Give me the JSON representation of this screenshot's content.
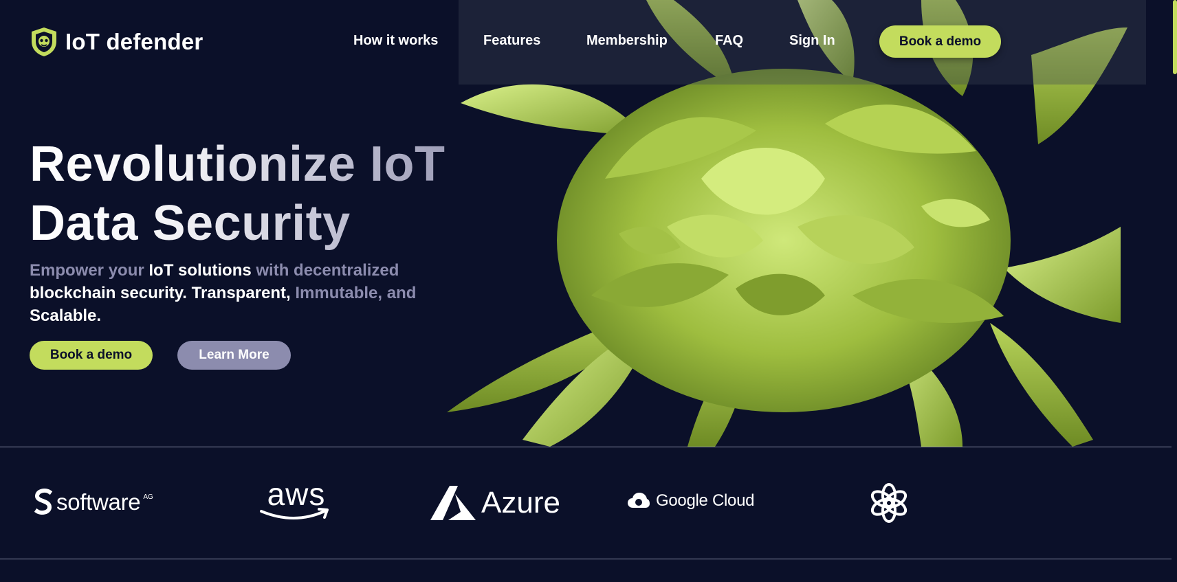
{
  "brand": {
    "name": "IoT defender",
    "icon": "shield-logo-icon",
    "accent_color": "#c3dc5d",
    "background_color": "#0b1029",
    "muted_text_color": "#8c8cae"
  },
  "nav": {
    "items": [
      {
        "label": "How it works"
      },
      {
        "label": "Features"
      },
      {
        "label": "Membership"
      },
      {
        "label": "FAQ"
      },
      {
        "label": "Sign In"
      }
    ],
    "cta_label": "Book a demo"
  },
  "hero": {
    "title_line1": "Revolutionize IoT",
    "title_line2": "Data Security",
    "subtitle_parts": [
      {
        "text": "Empower your ",
        "tone": "muted"
      },
      {
        "text": "IoT solutions",
        "tone": "bright"
      },
      {
        "text": " with decentralized ",
        "tone": "muted"
      },
      {
        "text": "blockchain security. Transparent, ",
        "tone": "bright"
      },
      {
        "text": "Immutable, and ",
        "tone": "muted"
      },
      {
        "text": "Scalable.",
        "tone": "bright"
      }
    ],
    "primary_button": "Book a demo",
    "secondary_button": "Learn More",
    "art": "green-abstract-flower-image"
  },
  "partners": [
    {
      "name": "software",
      "suffix": "AG",
      "icon": "software-ag-logo-icon"
    },
    {
      "name": "aws",
      "icon": "aws-logo-icon"
    },
    {
      "name": "Azure",
      "icon": "azure-logo-icon"
    },
    {
      "name": "Google Cloud",
      "icon": "google-cloud-logo-icon"
    },
    {
      "name": "",
      "icon": "openai-logo-icon"
    }
  ]
}
